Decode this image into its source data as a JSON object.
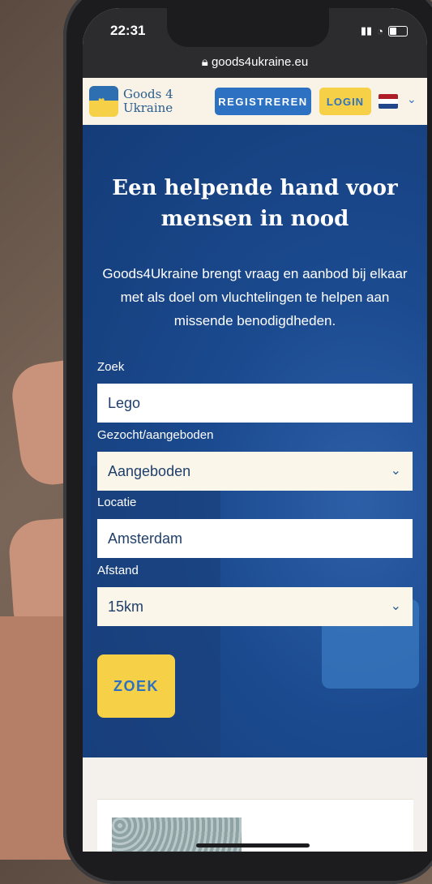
{
  "status": {
    "time": "22:31"
  },
  "browser": {
    "url": "goods4ukraine.eu"
  },
  "nav": {
    "logo_line1": "Goods 4",
    "logo_line2": "Ukraine",
    "register_label": "REGISTREREN",
    "login_label": "LOGIN",
    "language": "nl-flag-icon"
  },
  "hero": {
    "title": "Een helpende hand voor mensen in nood",
    "subtitle": "Goods4Ukraine brengt vraag en aanbod bij elkaar met als doel om vluchtelingen te helpen aan missende benodigdheden."
  },
  "search": {
    "query_label": "Zoek",
    "query_value": "Lego",
    "type_label": "Gezocht/aangeboden",
    "type_value": "Aangeboden",
    "location_label": "Locatie",
    "location_value": "Amsterdam",
    "distance_label": "Afstand",
    "distance_value": "15km",
    "submit_label": "ZOEK"
  },
  "colors": {
    "brand_blue": "#2d72c2",
    "brand_yellow": "#f6d046"
  }
}
